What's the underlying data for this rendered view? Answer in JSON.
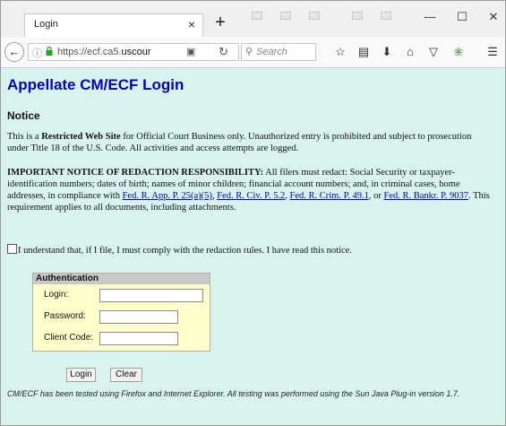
{
  "browser": {
    "tab_title": "Login",
    "tab_close": "×",
    "new_tab": "+",
    "url_prefix": "https://ecf.ca5.",
    "url_domain": "uscour",
    "search_placeholder": "Search",
    "window_controls": {
      "minimize": "—",
      "maximize": "☐",
      "close": "✕"
    },
    "toolbar_icons": [
      "star-icon",
      "library-icon",
      "download-icon",
      "home-icon",
      "pocket-icon",
      "extension-icon",
      "menu-icon"
    ]
  },
  "page": {
    "title": "Appellate CM/ECF Login",
    "notice_heading": "Notice",
    "notice_para": {
      "before": "This is a ",
      "bold": "Restricted Web Site",
      "after": " for Official Court Business only. Unauthorized entry is prohibited and subject to prosecution under Title 18 of the U.S. Code. All activities and access attempts are logged."
    },
    "redaction_para": {
      "bold": "IMPORTANT NOTICE OF REDACTION RESPONSIBILITY:",
      "text1": " All filers must redact: Social Security or taxpayer-identification numbers; dates of birth; names of minor children; financial account numbers; and, in criminal cases, home addresses, in compliance with ",
      "link1": "Fed. R. App. P. 25(a)(5)",
      "sep1": ", ",
      "link2": "Fed. R. Civ. P. 5.2",
      "sep2": ", ",
      "link3": "Fed. R. Crim. P. 49.1",
      "sep3": ", or ",
      "link4": "Fed. R. Bankr. P. 9037",
      "text2": ". This requirement applies to all documents, including attachments."
    },
    "checkbox_label": "I understand that, if I file, I must comply with the redaction rules. I have read this notice.",
    "auth": {
      "heading": "Authentication",
      "login_label": "Login:",
      "password_label": "Password:",
      "client_code_label": "Client Code:",
      "login_value": "",
      "password_value": "",
      "client_code_value": ""
    },
    "buttons": {
      "login": "Login",
      "clear": "Clear"
    },
    "footnote": "CM/ECF has been tested using Firefox and Internet Explorer. All testing was performed using the Sun Java Plug-in version 1.7."
  },
  "colors": {
    "page_background": "#d9f4ee",
    "title_color": "#0000c0",
    "link_color": "#0000cc",
    "auth_background": "#ffffcc"
  }
}
